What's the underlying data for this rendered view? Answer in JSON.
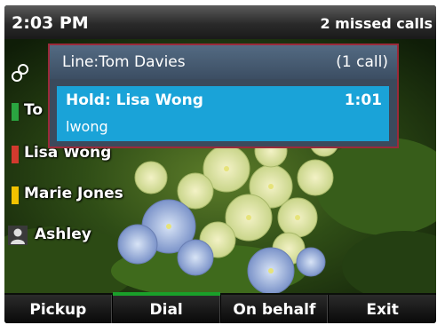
{
  "status_bar": {
    "time": "2:03 PM",
    "missed_calls": "2 missed calls"
  },
  "line_keys": [
    {
      "icon": "contact-card-icon",
      "label": "",
      "indicator_color": ""
    },
    {
      "icon": "",
      "label": "To",
      "indicator_color": "#2aa640"
    },
    {
      "icon": "",
      "label": "Lisa Wong",
      "indicator_color": "#d23a2e"
    },
    {
      "icon": "",
      "label": "Marie Jones",
      "indicator_color": "#f2c200"
    },
    {
      "icon": "person-icon",
      "label": "Ashley",
      "indicator_color": ""
    }
  ],
  "call_popup": {
    "line": "Line:Tom Davies",
    "call_count": "(1 call)",
    "call": {
      "state": "Hold: Lisa Wong",
      "timer": "1:01",
      "user": "lwong"
    }
  },
  "softkeys": [
    {
      "label": "Pickup"
    },
    {
      "label": "Dial",
      "active": true
    },
    {
      "label": "On behalf"
    },
    {
      "label": "Exit"
    }
  ],
  "colors": {
    "popup_border": "#9b2a3b",
    "call_highlight": "#1aa3d8",
    "softkey_active": "#1aa02a"
  }
}
